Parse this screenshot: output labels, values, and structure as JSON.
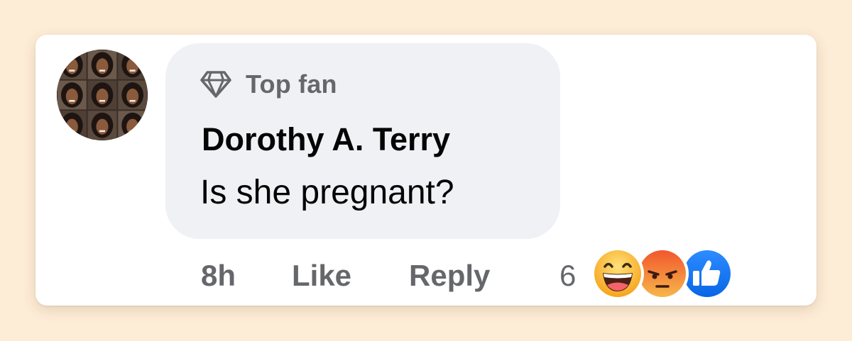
{
  "comment": {
    "badge": {
      "icon": "diamond-icon",
      "label": "Top fan"
    },
    "author": "Dorothy A. Terry",
    "text": "Is she pregnant?",
    "avatar": {
      "icon": "profile-photo-collage"
    }
  },
  "actions": {
    "time": "8h",
    "like": "Like",
    "reply": "Reply"
  },
  "reactions": {
    "count": "6",
    "types": [
      "haha-icon",
      "angry-icon",
      "like-icon"
    ],
    "colors": {
      "haha": "#f7b125",
      "angry": "#e9710f",
      "like": "#1877f2"
    }
  },
  "colors": {
    "background": "#fdecd6",
    "card": "#ffffff",
    "bubble": "#f0f1f5",
    "secondary_text": "#65676b",
    "primary_text": "#050505"
  }
}
